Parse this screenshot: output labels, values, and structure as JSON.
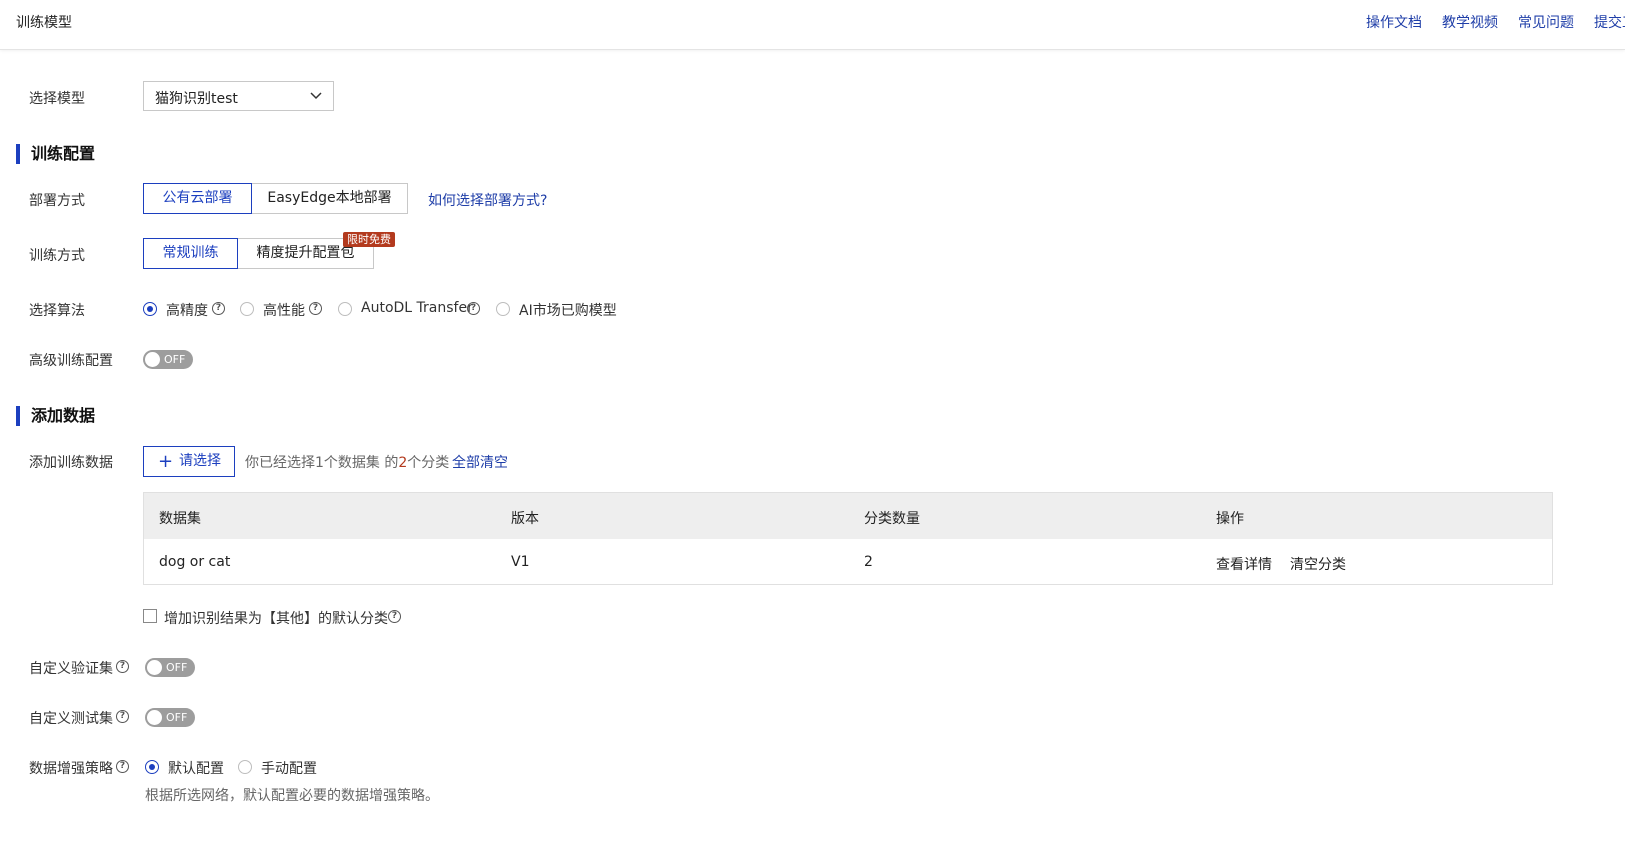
{
  "header": {
    "title": "训练模型",
    "links": [
      "操作文档",
      "教学视频",
      "常见问题",
      "提交工单"
    ]
  },
  "model": {
    "label": "选择模型",
    "value": "猫狗识别test"
  },
  "train_config": {
    "section_title": "训练配置",
    "deploy": {
      "label": "部署方式",
      "options": [
        "公有云部署",
        "EasyEdge本地部署"
      ],
      "selected": "公有云部署",
      "help_link": "如何选择部署方式?"
    },
    "train_mode": {
      "label": "训练方式",
      "options": [
        "常规训练",
        "精度提升配置包"
      ],
      "selected": "常规训练",
      "badge": "限时免费"
    },
    "algorithm": {
      "label": "选择算法",
      "options": [
        "高精度",
        "高性能",
        "AutoDL Transfer",
        "AI市场已购模型"
      ],
      "selected": "高精度"
    },
    "advanced": {
      "label": "高级训练配置",
      "toggle": "OFF"
    }
  },
  "add_data": {
    "section_title": "添加数据",
    "label": "添加训练数据",
    "select_button": "请选择",
    "summary_prefix": "你已经选择1个数据集 的",
    "summary_count": "2",
    "summary_suffix": "个分类",
    "clear_all": "全部清空",
    "table": {
      "columns": [
        "数据集",
        "版本",
        "分类数量",
        "操作"
      ],
      "rows": [
        {
          "dataset": "dog or cat",
          "version": "V1",
          "count": "2",
          "actions": [
            "查看详情",
            "清空分类"
          ]
        }
      ]
    },
    "other_checkbox": "增加识别结果为【其他】的默认分类"
  },
  "validation": {
    "label": "自定义验证集",
    "toggle": "OFF"
  },
  "test": {
    "label": "自定义测试集",
    "toggle": "OFF"
  },
  "augment": {
    "label": "数据增强策略",
    "options": [
      "默认配置",
      "手动配置"
    ],
    "selected": "默认配置",
    "hint": "根据所选网络，默认配置必要的数据增强策略。"
  },
  "colors": {
    "accent": "#1c3fbf",
    "badge": "#b33a1e",
    "toggle_off": "#9d9d9d"
  }
}
